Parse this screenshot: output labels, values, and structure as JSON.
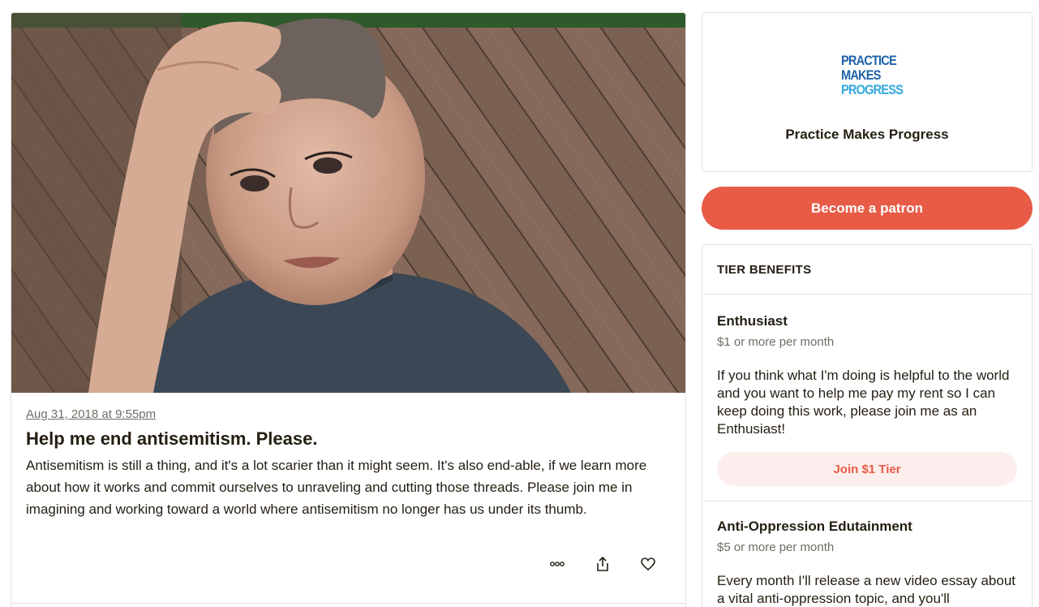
{
  "post": {
    "date": "Aug 31, 2018 at 9:55pm",
    "title": "Help me end antisemitism. Please.",
    "body": "Antisemitism is still a thing, and it's a lot scarier than it might seem. It's also end-able, if we learn more about how it works and commit ourselves to unraveling and cutting those threads. Please join me in imagining and working toward a world where antisemitism no longer has us under its thumb.",
    "actions": [
      {
        "name": "more-options",
        "icon": "ellipsis-icon"
      },
      {
        "name": "share",
        "icon": "share-icon"
      },
      {
        "name": "like",
        "icon": "heart-icon"
      }
    ]
  },
  "creator": {
    "logo_lines": [
      "PRACTICE",
      "MAKES",
      "PROGRESS"
    ],
    "name": "Practice Makes Progress"
  },
  "cta": {
    "label": "Become a patron"
  },
  "tier_benefits": {
    "heading": "TIER BENEFITS",
    "tiers": [
      {
        "name": "Enthusiast",
        "price": "$1 or more per month",
        "description": "If you think what I'm doing is helpful to the world and you want to help me pay my rent so I can keep doing this work, please join me as an Enthusiast!",
        "button": "Join $1 Tier"
      },
      {
        "name": "Anti-Oppression Edutainment",
        "price": "$5 or more per month",
        "description": "Every month I'll release a new video essay about a vital anti-oppression topic, and you'll"
      }
    ]
  },
  "colors": {
    "accent": "#e85b46",
    "accent_soft": "#fbeeec",
    "logo_dark": "#1f63a8",
    "logo_light": "#33a8dd",
    "text": "#241e12",
    "muted": "#706c64",
    "border": "#e5e3dd"
  }
}
